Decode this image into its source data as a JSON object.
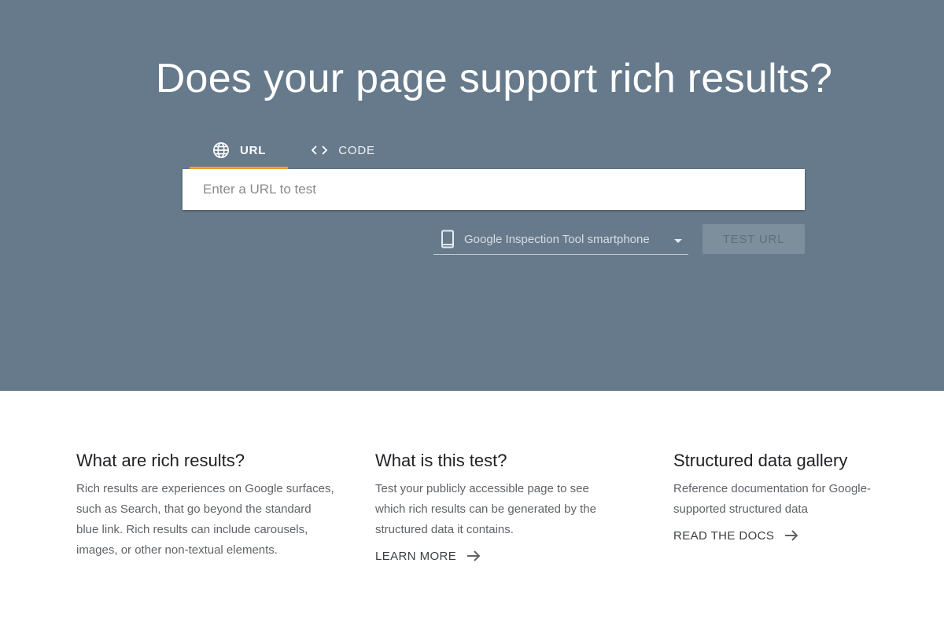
{
  "hero": {
    "title": "Does your page support rich results?",
    "background": "#667a8b"
  },
  "tabs": [
    {
      "label": "URL",
      "icon": "globe-icon",
      "active": true
    },
    {
      "label": "CODE",
      "icon": "code-icon",
      "active": false
    }
  ],
  "accent_color": "#f5a623",
  "url_input": {
    "placeholder": "Enter a URL to test",
    "value": ""
  },
  "device_select": {
    "selected": "Google Inspection Tool smartphone",
    "icon": "smartphone-icon"
  },
  "test_button": {
    "label": "TEST URL"
  },
  "info": [
    {
      "heading": "What are rich results?",
      "body": "Rich results are experiences on Google surfaces, such as Search, that go beyond the standard blue link. Rich results can include carousels, images, or other non-textual elements."
    },
    {
      "heading": "What is this test?",
      "body": "Test your publicly accessible page to see which rich results can be generated by the structured data it contains.",
      "link": "LEARN MORE"
    },
    {
      "heading": "Structured data gallery",
      "body": "Reference documentation for Google-supported structured data",
      "link": "READ THE DOCS"
    }
  ]
}
